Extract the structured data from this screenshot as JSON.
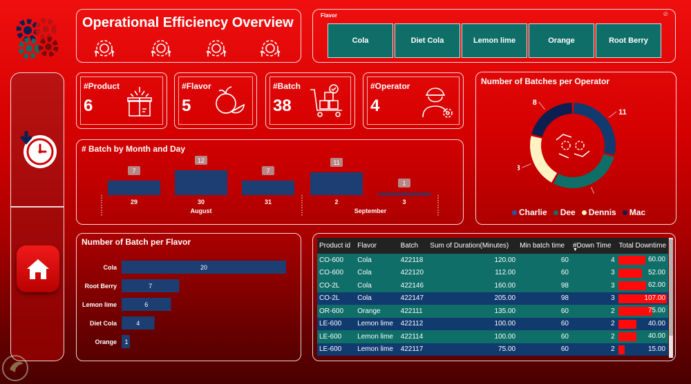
{
  "title": "Operational Efficiency Overview",
  "flavor_slicer": {
    "label": "Flavor",
    "options": [
      "Cola",
      "Diet Cola",
      "Lemon lime",
      "Orange",
      "Root Berry"
    ]
  },
  "kpis": [
    {
      "label": "#Product",
      "value": "6",
      "icon": "gift-box-icon"
    },
    {
      "label": "#Flavor",
      "value": "5",
      "icon": "fruit-icon"
    },
    {
      "label": "#Batch",
      "value": "38",
      "icon": "cart-boxes-icon"
    },
    {
      "label": "#Operator",
      "value": "4",
      "icon": "worker-icon"
    }
  ],
  "nav": {
    "items": [
      "clock-icon",
      "home-icon"
    ]
  },
  "colors": {
    "teal": "#0f6e68",
    "navy": "#113a6e",
    "cream": "#fff3c4",
    "bar": "#1d3e73",
    "red": "#ff0a0a"
  },
  "operators_chart": {
    "title": "Number of Batches per Operator",
    "legend": [
      "Charlie",
      "Dee",
      "Dennis",
      "Mac"
    ]
  },
  "month_chart": {
    "title": "# Batch by Month and Day"
  },
  "flavor_chart": {
    "title": "Number of Batch per Flavor"
  },
  "chart_data": [
    {
      "type": "pie",
      "title": "Number of Batches per Operator",
      "labels": [
        "Charlie",
        "Dee",
        "Dennis",
        "Mac"
      ],
      "values": [
        11,
        11,
        8,
        8
      ],
      "colors": [
        "#113a6e",
        "#0f6e68",
        "#fff3c4",
        "#0d1f50"
      ],
      "legend_position": "bottom"
    },
    {
      "type": "bar",
      "title": "# Batch by Month and Day",
      "categories": [
        "29",
        "30",
        "31",
        "2",
        "3"
      ],
      "groups": [
        {
          "name": "August",
          "categories": [
            "29",
            "30",
            "31"
          ]
        },
        {
          "name": "September",
          "categories": [
            "2",
            "3"
          ]
        }
      ],
      "values": [
        7,
        12,
        7,
        11,
        1
      ]
    },
    {
      "type": "bar",
      "orientation": "horizontal",
      "title": "Number of Batch per Flavor",
      "categories": [
        "Cola",
        "Root Berry",
        "Lemon lime",
        "Diet Cola",
        "Orange"
      ],
      "values": [
        20,
        7,
        6,
        4,
        1
      ]
    }
  ],
  "table": {
    "columns": [
      "Product id",
      "Flavor",
      "Batch",
      "Sum of Duration(Minutes)",
      "Min batch time",
      "#Down Time",
      "Total Downtime"
    ],
    "sort_indicator": "▼",
    "rows": [
      {
        "product": "CO-600",
        "flavor": "Cola",
        "batch": "422118",
        "duration": "120.00",
        "min": "60",
        "down": "4",
        "total": "60.00",
        "total_value": 60
      },
      {
        "product": "CO-600",
        "flavor": "Cola",
        "batch": "422120",
        "duration": "112.00",
        "min": "60",
        "down": "3",
        "total": "52.00",
        "total_value": 52
      },
      {
        "product": "CO-2L",
        "flavor": "Cola",
        "batch": "422146",
        "duration": "160.00",
        "min": "98",
        "down": "3",
        "total": "62.00",
        "total_value": 62
      },
      {
        "product": "CO-2L",
        "flavor": "Cola",
        "batch": "422147",
        "duration": "205.00",
        "min": "98",
        "down": "3",
        "total": "107.00",
        "total_value": 107
      },
      {
        "product": "OR-600",
        "flavor": "Orange",
        "batch": "422111",
        "duration": "135.00",
        "min": "60",
        "down": "2",
        "total": "75.00",
        "total_value": 75
      },
      {
        "product": "LE-600",
        "flavor": "Lemon lime",
        "batch": "422112",
        "duration": "100.00",
        "min": "60",
        "down": "2",
        "total": "40.00",
        "total_value": 40
      },
      {
        "product": "LE-600",
        "flavor": "Lemon lime",
        "batch": "422114",
        "duration": "100.00",
        "min": "60",
        "down": "2",
        "total": "40.00",
        "total_value": 40
      },
      {
        "product": "LE-600",
        "flavor": "Lemon lime",
        "batch": "422117",
        "duration": "75.00",
        "min": "60",
        "down": "2",
        "total": "15.00",
        "total_value": 15
      }
    ]
  }
}
